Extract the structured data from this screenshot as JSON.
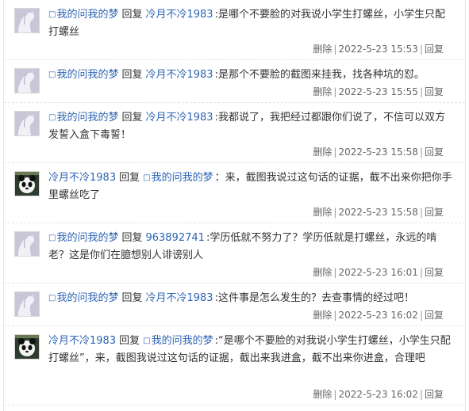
{
  "ui": {
    "reply_word": "回复",
    "delete_label": "删除",
    "reply_label": "回复",
    "separator": "|",
    "box_glyph": "□"
  },
  "replies": [
    {
      "avatar": "avatar-white-horse-icon",
      "author": "我的问我的梦",
      "target": "冷月不冷1983",
      "text": ":是哪个不要脸的对我说小学生打螺丝，小学生只配打螺丝",
      "time": "2022-5-23 15:53"
    },
    {
      "avatar": "avatar-white-horse-icon",
      "author": "我的问我的梦",
      "target": "冷月不冷1983",
      "text": ":是那个不要脸的截图来挂我，找各种坑的怼。",
      "time": "2022-5-23 15:55"
    },
    {
      "avatar": "avatar-white-horse-icon",
      "author": "我的问我的梦",
      "target": "冷月不冷1983",
      "text": ":我都说了，我把经过都跟你们说了，不信可以双方发誓入盒下毒誓！",
      "time": "2022-5-23 15:58"
    },
    {
      "avatar": "avatar-panda-icon",
      "author": "冷月不冷1983",
      "target": "我的问我的梦",
      "text": "：来，截图我说过这句话的证据，截不出来你把你手里螺丝吃了",
      "time": "2022-5-23 15:58"
    },
    {
      "avatar": "avatar-white-horse-icon",
      "author": "我的问我的梦",
      "target": "963892741",
      "text": ":学历低就不努力了？学历低就是打螺丝，永远的啃老？这是你们在臆想别人诽谤别人",
      "time": "2022-5-23 16:01"
    },
    {
      "avatar": "avatar-white-horse-icon",
      "author": "我的问我的梦",
      "target": "冷月不冷1983",
      "text": ":这件事是怎么发生的？去查事情的经过吧！",
      "time": "2022-5-23 16:02"
    },
    {
      "avatar": "avatar-panda-icon",
      "author": "冷月不冷1983",
      "target": "我的问我的梦",
      "text": ":“是哪个不要脸的对我说小学生打螺丝，小学生只配打螺丝”，来，截图我说过这句话的证据，截出来我进盒，截不出来你进盒，合理吧",
      "time": "2022-5-23 16:02"
    }
  ]
}
